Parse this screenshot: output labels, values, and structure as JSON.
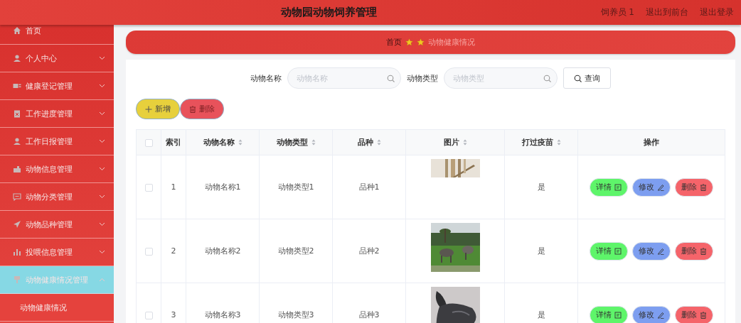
{
  "header": {
    "title": "动物园动物饲养管理",
    "user": "饲养员 1",
    "links": [
      "退出到前台",
      "退出登录"
    ]
  },
  "sidebar": {
    "items": [
      {
        "label": "首页",
        "kind": "link",
        "selected": false
      },
      {
        "label": "个人中心",
        "kind": "menu",
        "selected": false,
        "expanded": false
      },
      {
        "label": "健康登记管理",
        "kind": "menu",
        "selected": false,
        "expanded": false
      },
      {
        "label": "工作进度管理",
        "kind": "menu",
        "selected": false,
        "expanded": false
      },
      {
        "label": "工作日报管理",
        "kind": "menu",
        "selected": false,
        "expanded": false
      },
      {
        "label": "动物信息管理",
        "kind": "menu",
        "selected": false,
        "expanded": false
      },
      {
        "label": "动物分类管理",
        "kind": "menu",
        "selected": false,
        "expanded": false
      },
      {
        "label": "动物品种管理",
        "kind": "menu",
        "selected": false,
        "expanded": false
      },
      {
        "label": "投喂信息管理",
        "kind": "menu",
        "selected": false,
        "expanded": false
      },
      {
        "label": "动物健康情况管理",
        "kind": "menu",
        "selected": true,
        "expanded": true,
        "children": [
          {
            "label": "动物健康情况"
          }
        ]
      }
    ]
  },
  "breadcrumb": {
    "home": "首页",
    "current": "动物健康情况"
  },
  "search": {
    "fields": [
      {
        "label": "动物名称",
        "placeholder": "动物名称"
      },
      {
        "label": "动物类型",
        "placeholder": "动物类型"
      }
    ],
    "button": "查询"
  },
  "toolbar": [
    {
      "kind": "add",
      "label": "新增"
    },
    {
      "kind": "delete",
      "label": "删除"
    }
  ],
  "table": {
    "select_all": {
      "checked": false
    },
    "columns": [
      {
        "label": "索引",
        "sortable": false
      },
      {
        "label": "动物名称",
        "sortable": true
      },
      {
        "label": "动物类型",
        "sortable": true
      },
      {
        "label": "品种",
        "sortable": true
      },
      {
        "label": "图片",
        "sortable": true
      },
      {
        "label": "打过疫苗",
        "sortable": true
      },
      {
        "label": "操作",
        "sortable": false
      }
    ],
    "rows": [
      {
        "checked": false,
        "index": "1",
        "name": "动物名称1",
        "type": "动物类型1",
        "breed": "品种1",
        "vaccinated": "是",
        "actions": [
          {
            "kind": "detail",
            "label": "详情"
          },
          {
            "kind": "edit",
            "label": "修改"
          },
          {
            "kind": "delete",
            "label": "删除"
          }
        ]
      },
      {
        "checked": false,
        "index": "2",
        "name": "动物名称2",
        "type": "动物类型2",
        "breed": "品种2",
        "vaccinated": "是",
        "actions": [
          {
            "kind": "detail",
            "label": "详情"
          },
          {
            "kind": "edit",
            "label": "修改"
          },
          {
            "kind": "delete",
            "label": "删除"
          }
        ]
      },
      {
        "checked": false,
        "index": "3",
        "name": "动物名称3",
        "type": "动物类型3",
        "breed": "品种3",
        "vaccinated": "是",
        "actions": [
          {
            "kind": "detail",
            "label": "详情"
          },
          {
            "kind": "edit",
            "label": "修改"
          },
          {
            "kind": "delete",
            "label": "删除"
          }
        ]
      }
    ]
  }
}
